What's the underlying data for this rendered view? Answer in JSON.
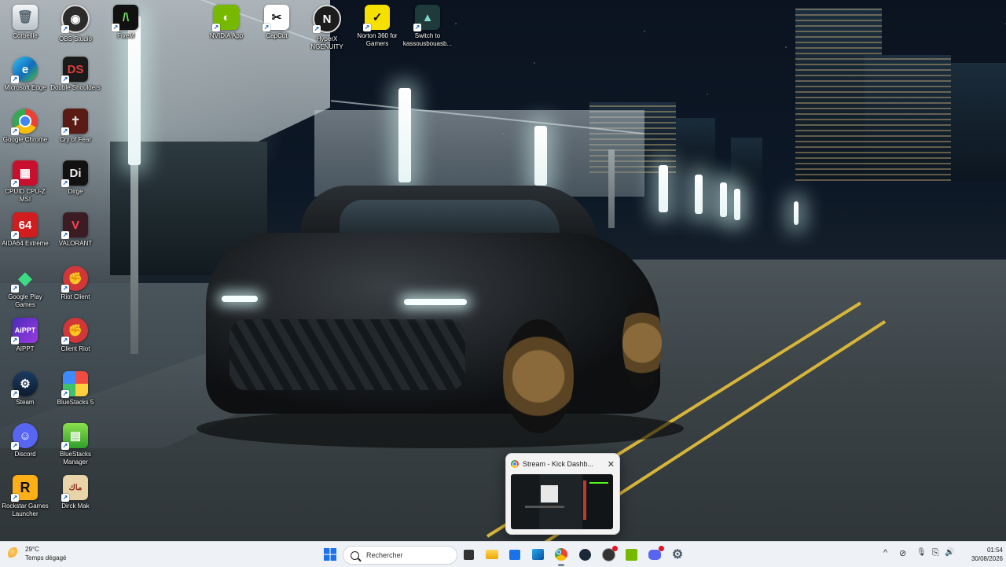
{
  "desktop": {
    "icons": [
      {
        "label": "Corbeille"
      },
      {
        "label": "OBS Studio"
      },
      {
        "label": "FiveM"
      },
      {
        "label": "NVIDIA App"
      },
      {
        "label": "CapCut"
      },
      {
        "label": "HyperX NGENUITY"
      },
      {
        "label": "Norton 360 for Gamers"
      },
      {
        "label": "Switch to kassousbouasb..."
      },
      {
        "label": "Microsoft Edge"
      },
      {
        "label": "Double Shoulders"
      },
      {
        "label": "Google Chrome"
      },
      {
        "label": "Cry of Fear"
      },
      {
        "label": "CPUID CPU-Z MSI"
      },
      {
        "label": "Dirge"
      },
      {
        "label": "AIDA64 Extreme"
      },
      {
        "label": "VALORANT"
      },
      {
        "label": "Google Play Games"
      },
      {
        "label": "Riot Client"
      },
      {
        "label": "AIPPT"
      },
      {
        "label": "Client Riot"
      },
      {
        "label": "Steam"
      },
      {
        "label": "BlueStacks 5"
      },
      {
        "label": "Discord"
      },
      {
        "label": "BlueStacks Manager"
      },
      {
        "label": "Rockstar Games Launcher"
      },
      {
        "label": "Dirck Mak"
      }
    ]
  },
  "thumbnail": {
    "title": "Stream - Kick Dashb...",
    "close_glyph": "✕"
  },
  "taskbar": {
    "weather": {
      "temp": "29°C",
      "desc": "Temps dégagé"
    },
    "search_placeholder": "Rechercher",
    "clock": {
      "time": "01:54",
      "date": "30/08/2026"
    },
    "tray_glyphs": {
      "chevron": "^",
      "wifi_off": "⊘",
      "mic": "🎙",
      "network": "⎘",
      "volume": "🔊",
      "pen": "✎"
    }
  },
  "colors": {
    "taskbar_bg": "#eef1f5",
    "accent_windows": "#1a73e8"
  }
}
